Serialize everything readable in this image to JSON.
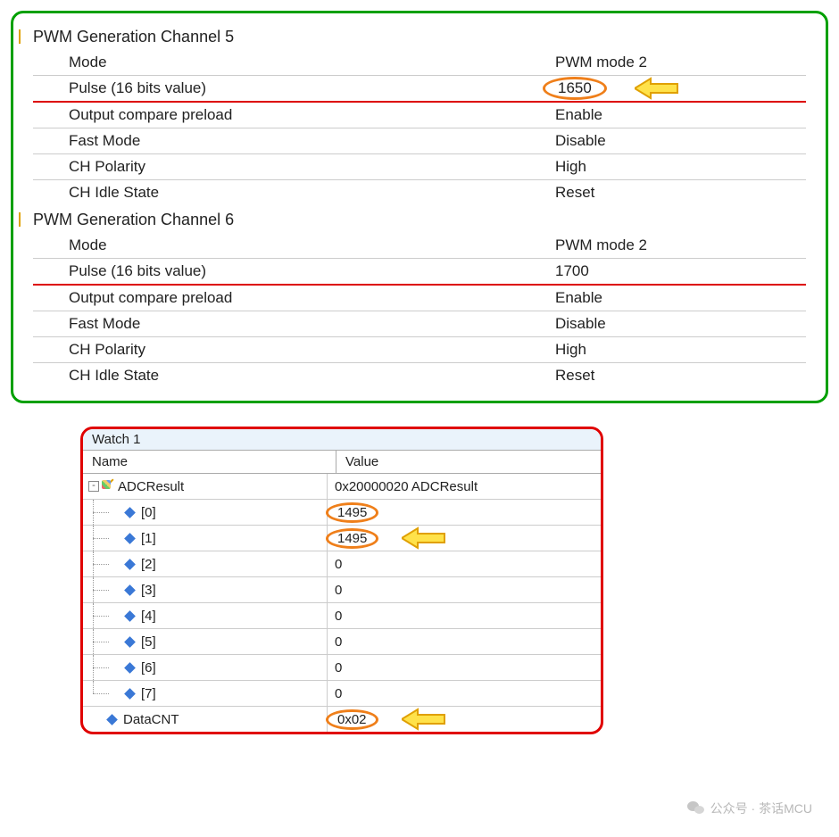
{
  "config": {
    "ch5": {
      "title": "PWM Generation Channel 5",
      "rows": [
        {
          "label": "Mode",
          "value": "PWM mode 2"
        },
        {
          "label": "Pulse (16 bits value)",
          "value": "1650"
        },
        {
          "label": "Output compare preload",
          "value": "Enable"
        },
        {
          "label": "Fast Mode",
          "value": "Disable"
        },
        {
          "label": "CH Polarity",
          "value": "High"
        },
        {
          "label": "CH Idle State",
          "value": "Reset"
        }
      ]
    },
    "ch6": {
      "title": "PWM Generation Channel 6",
      "rows": [
        {
          "label": "Mode",
          "value": "PWM mode 2"
        },
        {
          "label": "Pulse (16 bits value)",
          "value": "1700"
        },
        {
          "label": "Output compare preload",
          "value": "Enable"
        },
        {
          "label": "Fast Mode",
          "value": "Disable"
        },
        {
          "label": "CH Polarity",
          "value": "High"
        },
        {
          "label": "CH Idle State",
          "value": "Reset"
        }
      ]
    }
  },
  "watch": {
    "title": "Watch 1",
    "col_name": "Name",
    "col_value": "Value",
    "root": {
      "name": "ADCResult",
      "value": "0x20000020 ADCResult"
    },
    "items": [
      {
        "name": "[0]",
        "value": "1495"
      },
      {
        "name": "[1]",
        "value": "1495"
      },
      {
        "name": "[2]",
        "value": "0"
      },
      {
        "name": "[3]",
        "value": "0"
      },
      {
        "name": "[4]",
        "value": "0"
      },
      {
        "name": "[5]",
        "value": "0"
      },
      {
        "name": "[6]",
        "value": "0"
      },
      {
        "name": "[7]",
        "value": "0"
      }
    ],
    "datacnt": {
      "name": "DataCNT",
      "value": "0x02"
    }
  },
  "watermark": "公众号 · 茶话MCU"
}
